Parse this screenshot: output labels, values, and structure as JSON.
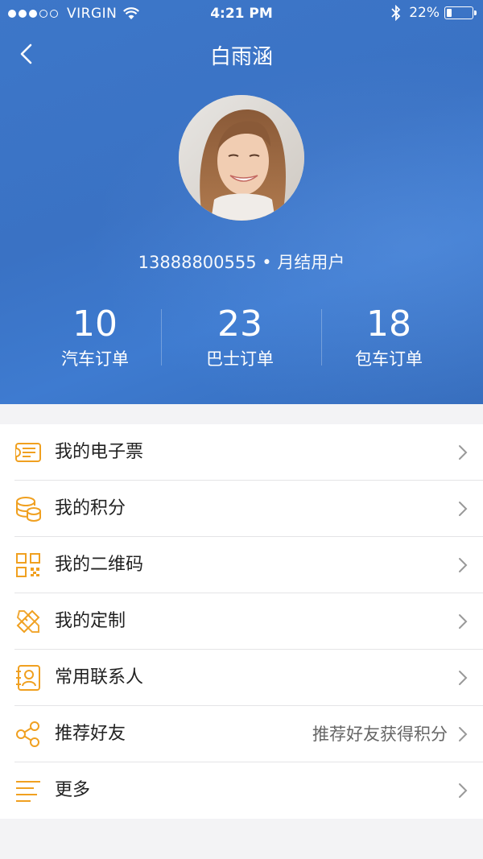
{
  "status_bar": {
    "carrier": "VIRGIN",
    "time": "4:21 PM",
    "battery": "22%",
    "battery_level": 0.22,
    "signal_bars": 3,
    "signal_total": 5
  },
  "nav": {
    "title": "白雨涵",
    "back_icon": "chevron-left-icon"
  },
  "profile": {
    "phone": "13888800555",
    "separator": "•",
    "user_type": "月结用户",
    "user_line": "13888800555 • 月结用户"
  },
  "stats": [
    {
      "value": "10",
      "label": "汽车订单"
    },
    {
      "value": "23",
      "label": "巴士订单"
    },
    {
      "value": "18",
      "label": "包车订单"
    }
  ],
  "menu": [
    {
      "label": "我的电子票",
      "icon": "ticket-icon",
      "sub": ""
    },
    {
      "label": "我的积分",
      "icon": "coins-icon",
      "sub": ""
    },
    {
      "label": "我的二维码",
      "icon": "qr-code-icon",
      "sub": ""
    },
    {
      "label": "我的定制",
      "icon": "pencil-ruler-icon",
      "sub": ""
    },
    {
      "label": "常用联系人",
      "icon": "contact-card-icon",
      "sub": ""
    },
    {
      "label": "推荐好友",
      "icon": "share-icon",
      "sub": "推荐好友获得积分"
    },
    {
      "label": "更多",
      "icon": "menu-lines-icon",
      "sub": ""
    }
  ],
  "colors": {
    "header_blue": "#3a72c4",
    "icon_orange": "#f0a020",
    "background": "#f3f3f5"
  }
}
